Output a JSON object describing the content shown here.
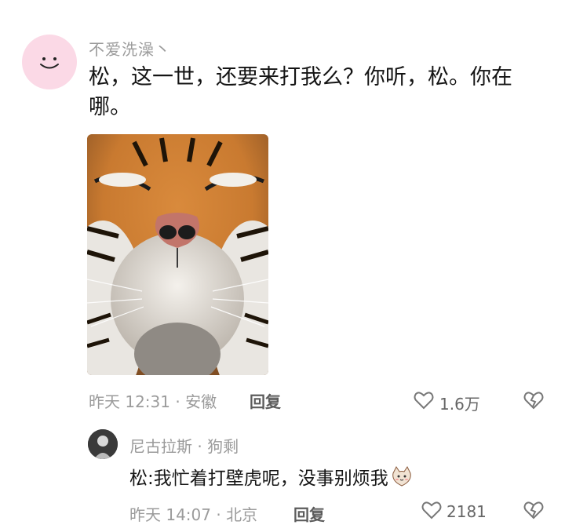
{
  "comment": {
    "username": "不爱洗澡丶",
    "text": "松，这一世，还要来打我么？你听，松。你在哪。",
    "meta": "昨天 12:31 · 安徽",
    "reply_label": "回复",
    "likes": "1.6万",
    "avatar_icon": "smiley-face-icon",
    "image_desc": "tiger-face-photo"
  },
  "reply": {
    "username": "尼古拉斯 · 狗剩",
    "text": "松:我忙着打壁虎呢，没事别烦我",
    "emoji": "cat-face-icon",
    "meta": "昨天 14:07 · 北京",
    "reply_label": "回复",
    "likes": "2181"
  },
  "colors": {
    "avatar_bg": "#fbd9e6",
    "meta_text": "#9b9b9b",
    "reply_text": "#5c5c5c"
  }
}
